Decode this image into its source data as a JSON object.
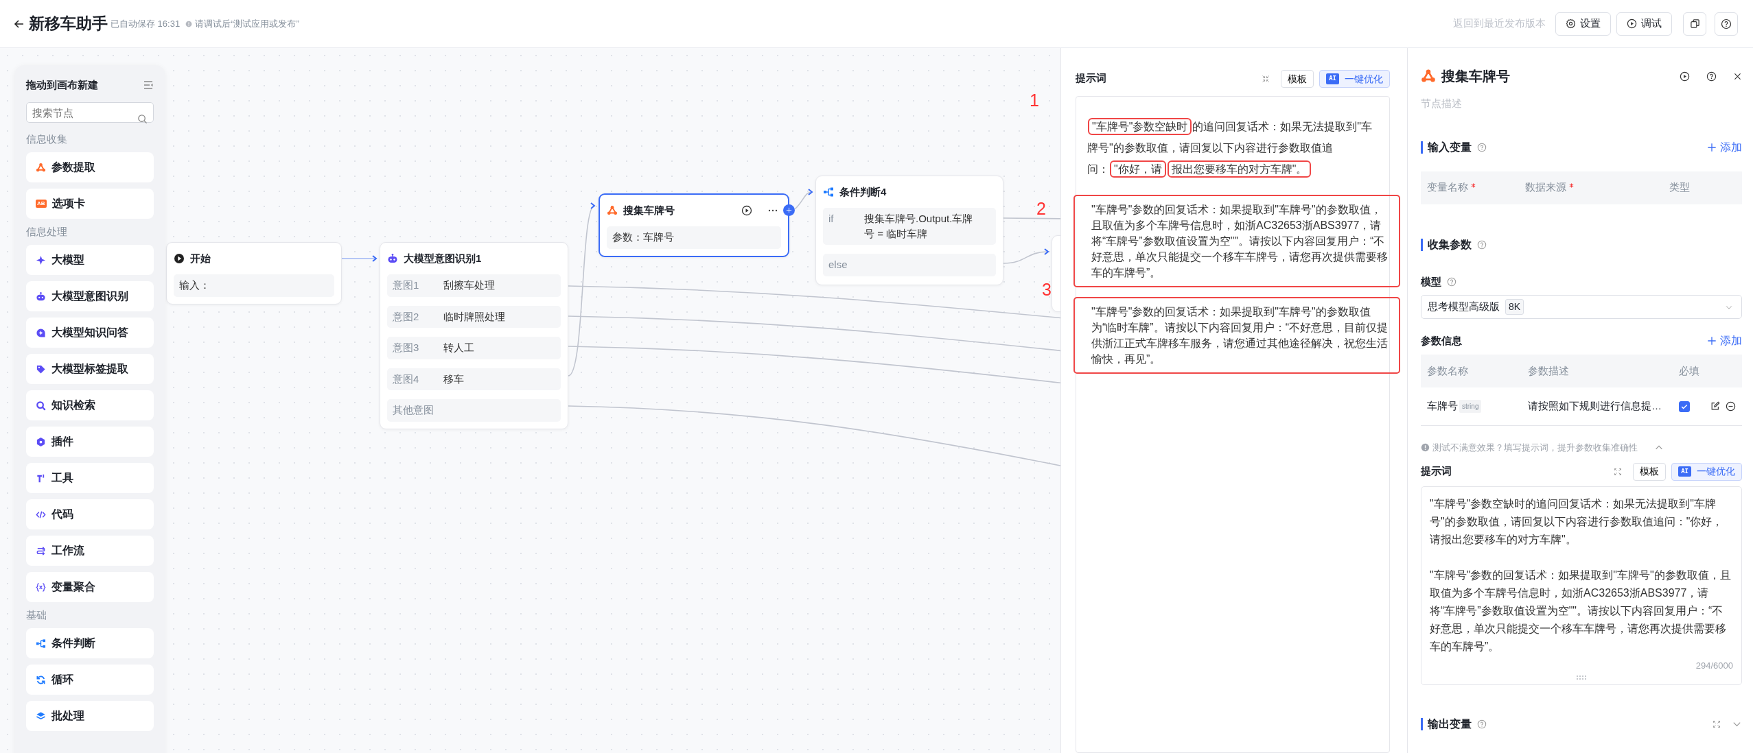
{
  "header": {
    "title": "新移车助手",
    "autosave": "已自动保存 16:31",
    "hint": "请调试后“测试应用或发布”",
    "revert": "返回到最近发布版本",
    "buttons": [
      "设置",
      "调试"
    ]
  },
  "sidebar": {
    "title": "拖动到画布新建",
    "search": {
      "placeholder": "搜索节点"
    },
    "groups": [
      {
        "label": "信息收集",
        "items": [
          {
            "label": "参数提取"
          },
          {
            "label": "选项卡",
            "badge": "AB"
          }
        ]
      },
      {
        "label": "信息处理",
        "items": [
          {
            "label": "大模型"
          },
          {
            "label": "大模型意图识别"
          },
          {
            "label": "大模型知识问答"
          },
          {
            "label": "大模型标签提取"
          },
          {
            "label": "知识检索"
          },
          {
            "label": "插件"
          },
          {
            "label": "工具"
          },
          {
            "label": "代码"
          },
          {
            "label": "工作流"
          },
          {
            "label": "变量聚合"
          }
        ]
      },
      {
        "label": "基础",
        "items": [
          {
            "label": "条件判断"
          },
          {
            "label": "循环"
          },
          {
            "label": "批处理"
          }
        ]
      }
    ]
  },
  "canvas": {
    "nodes": [
      {
        "kind": "start",
        "title": "开始",
        "selected": false,
        "rows": [
          {
            "label": "输入："
          }
        ]
      },
      {
        "kind": "intent",
        "title": "大模型意图识别1",
        "selected": false,
        "rows": [
          {
            "label": "意图1",
            "value": "刮擦车处理"
          },
          {
            "label": "意图2",
            "value": "临时牌照处理"
          },
          {
            "label": "意图3",
            "value": "转人工"
          },
          {
            "label": "意图4",
            "value": "移车"
          },
          {
            "label": "其他意图"
          }
        ]
      },
      {
        "kind": "collect",
        "title": "搜集车牌号",
        "selected": true,
        "rows": [
          {
            "label": "参数：车牌号"
          }
        ]
      },
      {
        "kind": "condition",
        "title": "条件判断4",
        "selected": false,
        "rows": [
          {
            "label": "if",
            "value": "搜集车牌号.Output.车牌号 = 临时车牌"
          },
          {
            "label": "else"
          }
        ]
      }
    ],
    "annotations": [
      "1",
      "2",
      "3"
    ]
  },
  "prompt_panel": {
    "title": "提示词",
    "buttons": [
      {
        "label": "模板"
      },
      {
        "label": "一键优化",
        "badge": "AI"
      }
    ],
    "paragraphs": [
      {
        "boxed": false,
        "segments": [
          {
            "text": "\"车牌号\"参数空缺时",
            "boxed": true
          },
          {
            "text": "的追问回复话术：如果无法提取到\"车牌号\"的参数取值，请回复以下内容进行参数取值追问：",
            "boxed": false
          },
          {
            "text": "\"你好，请",
            "boxed": true
          },
          {
            "text": "报出您要移车的对方车牌\"。",
            "boxed": true
          }
        ]
      },
      {
        "boxed": true,
        "segments": [
          {
            "text": "\"车牌号\"参数的回复话术：如果提取到\"车牌号\"的参数取值，且取值为多个车牌号信息时，如浙AC32653浙ABS3977，请将“车牌号”参数取值设置为空\"\"。请按以下内容回复用户：“不好意思，单次只能提交一个移车车牌号，请您再次提供需要移车的车牌号”。",
            "boxed": false
          }
        ]
      },
      {
        "boxed": true,
        "segments": [
          {
            "text": "\"车牌号\"参数的回复话术：如果提取到\"车牌号\"的参数取值为“临时车牌”。请按以下内容回复用户：“不好意思，目前仅提供浙江正式车牌移车服务，请您通过其他途径解决，祝您生活愉快，再见”。",
            "boxed": false
          }
        ]
      }
    ]
  },
  "node_panel": {
    "title": "搜集车牌号",
    "description": {
      "placeholder": "节点描述"
    },
    "input_vars": {
      "title": "输入变量",
      "add": "添加",
      "columns": [
        {
          "label": "变量名称",
          "required": true
        },
        {
          "label": "数据来源",
          "required": true
        },
        {
          "label": "类型",
          "required": false
        }
      ]
    },
    "collect": {
      "title": "收集参数",
      "model_label": "模型",
      "model": "思考模型高级版",
      "model_tag": "8K",
      "params_label": "参数信息",
      "add": "添加",
      "columns": [
        {
          "label": "参数名称"
        },
        {
          "label": "参数描述"
        },
        {
          "label": "必填"
        }
      ],
      "rows": [
        {
          "name": "车牌号",
          "type": "string",
          "description": "请按照如下规则进行信息提…",
          "required": true
        }
      ],
      "hint": "测试不满意效果？填写提示词，提升参数收集准确性",
      "hint_expanded": true,
      "prompt": {
        "title": "提示词",
        "buttons": [
          {
            "label": "模板"
          },
          {
            "label": "一键优化",
            "badge": "AI"
          }
        ],
        "paragraphs": [
          "\"车牌号\"参数空缺时的追问回复话术：如果无法提取到\"车牌号\"的参数取值，请回复以下内容进行参数取值追问：\"你好，请报出您要移车的对方车牌\"。",
          "\"车牌号\"参数的回复话术：如果提取到\"车牌号\"的参数取值，且取值为多个车牌号信息时，如浙AC32653浙ABS3977，请将“车牌号”参数取值设置为空\"\"。请按以下内容回复用户：“不好意思，单次只能提交一个移车车牌号，请您再次提供需要移车的车牌号”。"
        ],
        "counter": "294/6000"
      }
    },
    "output_vars": {
      "title": "输出变量",
      "expanded": false
    }
  }
}
